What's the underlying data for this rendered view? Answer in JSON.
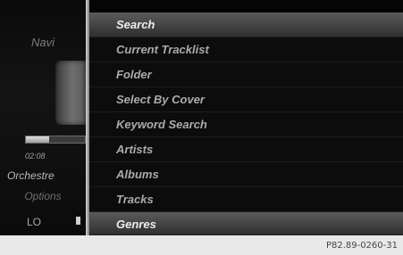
{
  "left_pane": {
    "navi_label": "Navi",
    "progress_fraction": 0.4,
    "track_time": "02:08",
    "track_title": "Orchestre",
    "options_label": "Options",
    "lo_label": "LO"
  },
  "menu": {
    "items": [
      {
        "label": "Search"
      },
      {
        "label": "Current Tracklist"
      },
      {
        "label": "Folder"
      },
      {
        "label": "Select By Cover"
      },
      {
        "label": "Keyword Search"
      },
      {
        "label": "Artists"
      },
      {
        "label": "Albums"
      },
      {
        "label": "Tracks"
      },
      {
        "label": "Genres"
      }
    ],
    "highlighted_items": [
      "Search",
      "Genres"
    ]
  },
  "footer": {
    "code": "P82.89-0260-31"
  },
  "colors": {
    "screen_background": "#050505",
    "highlight": "#5b5b5b",
    "text": "#ababab"
  }
}
